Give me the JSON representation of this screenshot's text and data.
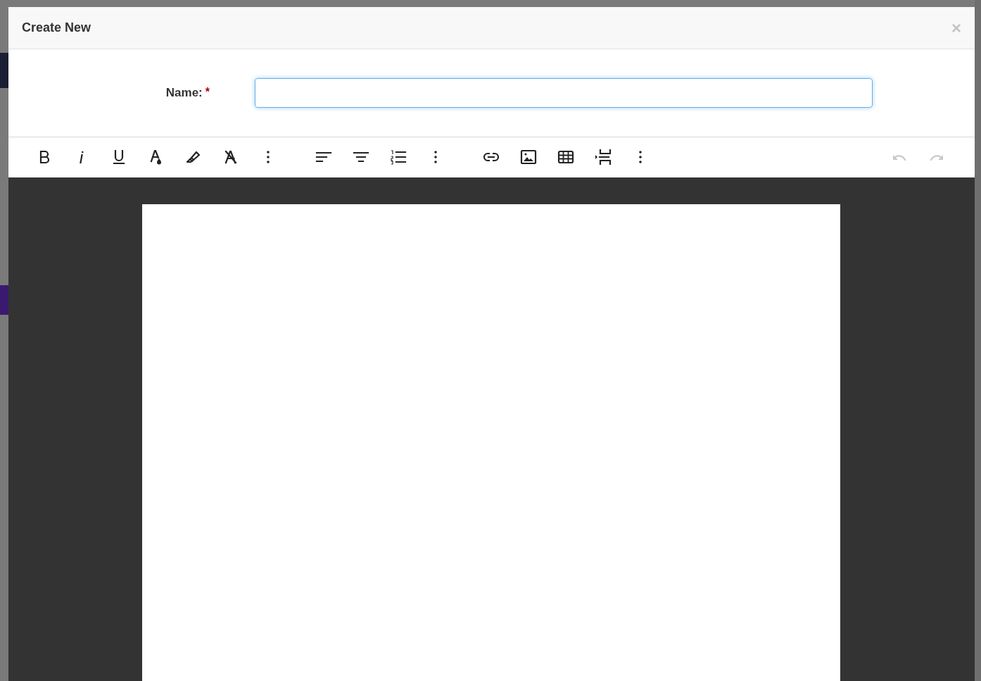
{
  "dialog": {
    "title": "Create New",
    "close": "×"
  },
  "form": {
    "name_label": "Name:",
    "required_mark": "*",
    "focused": true
  },
  "toolbar": {
    "groups": [
      [
        {
          "kind": "bold",
          "disabled": false
        },
        {
          "kind": "italic",
          "disabled": false
        },
        {
          "kind": "underline",
          "disabled": false
        },
        {
          "kind": "text-color",
          "disabled": false
        },
        {
          "kind": "highlight",
          "disabled": false
        },
        {
          "kind": "clear-format",
          "disabled": false
        },
        {
          "kind": "more",
          "disabled": false
        }
      ],
      [
        {
          "kind": "align",
          "disabled": false
        },
        {
          "kind": "center",
          "disabled": false
        },
        {
          "kind": "numbered-list",
          "disabled": false
        },
        {
          "kind": "more",
          "disabled": false
        }
      ],
      [
        {
          "kind": "link",
          "disabled": false
        },
        {
          "kind": "image",
          "disabled": false
        },
        {
          "kind": "table",
          "disabled": false
        },
        {
          "kind": "page-break",
          "disabled": false
        },
        {
          "kind": "more",
          "disabled": false
        }
      ]
    ],
    "history": [
      {
        "kind": "undo",
        "disabled": true
      },
      {
        "kind": "redo",
        "disabled": true
      }
    ]
  }
}
